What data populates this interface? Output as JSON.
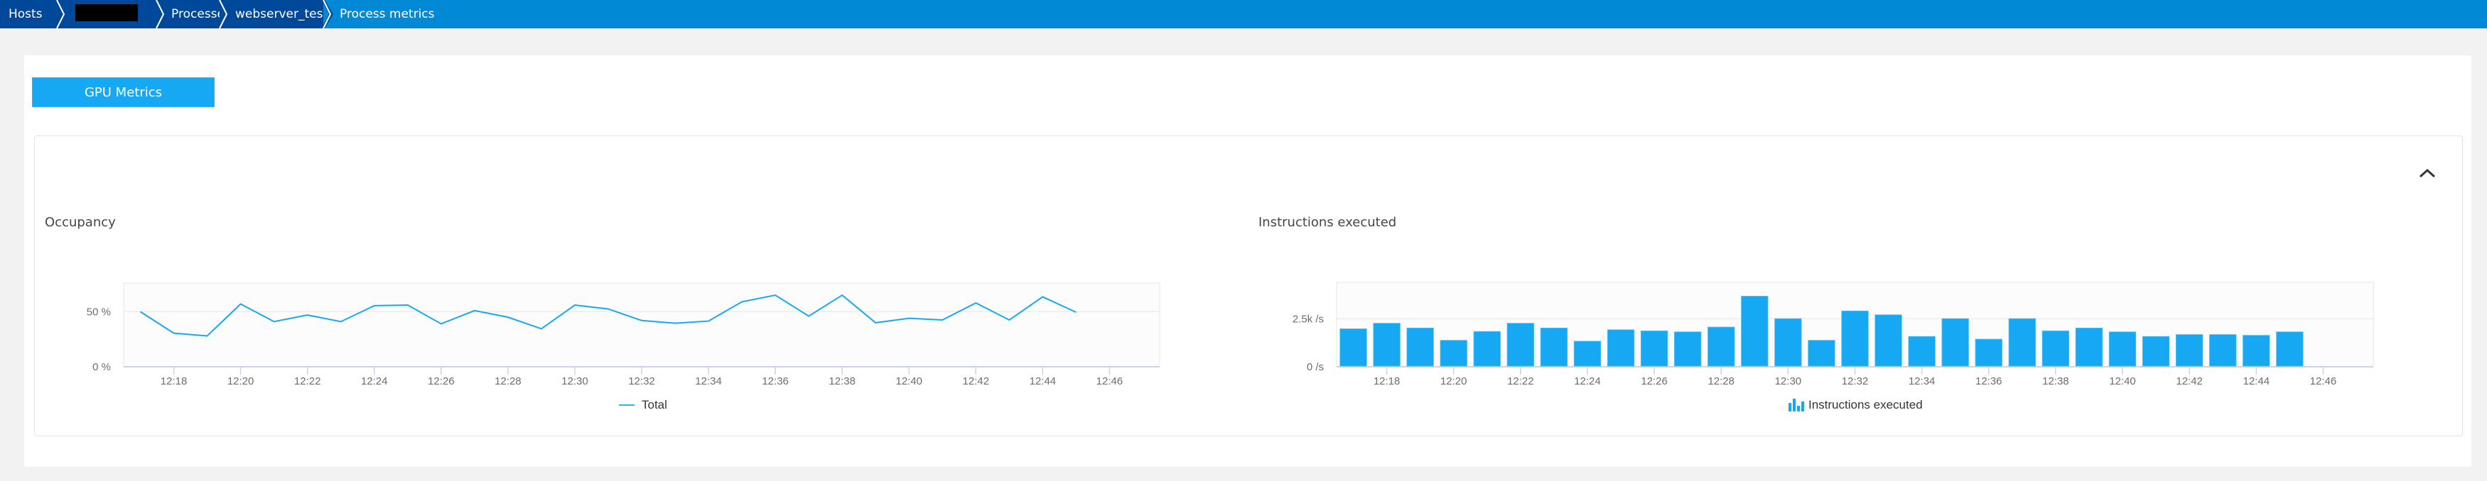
{
  "breadcrumb": {
    "items": [
      {
        "label": "Hosts"
      },
      {
        "label": "",
        "redacted": true
      },
      {
        "label": "Processes"
      },
      {
        "label": "webserver_test_app"
      },
      {
        "label": "Process metrics",
        "current": true
      }
    ]
  },
  "section": {
    "tab_label": "GPU Metrics",
    "collapse_icon": "chevron-up-icon"
  },
  "colors": {
    "breadcrumb_dark": "#00489a",
    "breadcrumb_current": "#0189d6",
    "accent": "#16a8f3",
    "series": "#16a8f3"
  },
  "chart_data": [
    {
      "type": "line",
      "title": "Occupancy",
      "xlabel": "",
      "ylabel": "",
      "x": [
        "12:17",
        "12:18",
        "12:19",
        "12:20",
        "12:21",
        "12:22",
        "12:23",
        "12:24",
        "12:25",
        "12:26",
        "12:27",
        "12:28",
        "12:29",
        "12:30",
        "12:31",
        "12:32",
        "12:33",
        "12:34",
        "12:35",
        "12:36",
        "12:37",
        "12:38",
        "12:39",
        "12:40",
        "12:41",
        "12:42",
        "12:43",
        "12:44",
        "12:45"
      ],
      "series": [
        {
          "name": "Total",
          "values": [
            50,
            30.5,
            28,
            57,
            41,
            47,
            41,
            55.5,
            56,
            39,
            51,
            45,
            34.5,
            56,
            52.5,
            42,
            39.5,
            41.5,
            59,
            65,
            46,
            65,
            40,
            44,
            42.5,
            58,
            42.5,
            63.5,
            49.5
          ]
        }
      ],
      "x_ticks": [
        "12:18",
        "12:20",
        "12:22",
        "12:24",
        "12:26",
        "12:28",
        "12:30",
        "12:32",
        "12:34",
        "12:36",
        "12:38",
        "12:40",
        "12:42",
        "12:44",
        "12:46"
      ],
      "y_ticks": [
        {
          "value": 0,
          "label": "0 %"
        },
        {
          "value": 50,
          "label": "50 %"
        }
      ],
      "ylim": [
        0,
        76
      ],
      "xlim": [
        "12:16.5",
        "12:47.5"
      ],
      "grid": true,
      "legend": {
        "position": "bottom-center",
        "entries": [
          "Total"
        ]
      }
    },
    {
      "type": "bar",
      "title": "Instructions executed",
      "xlabel": "",
      "ylabel": "",
      "x": [
        "12:17",
        "12:18",
        "12:19",
        "12:20",
        "12:21",
        "12:22",
        "12:23",
        "12:24",
        "12:25",
        "12:26",
        "12:27",
        "12:28",
        "12:29",
        "12:30",
        "12:31",
        "12:32",
        "12:33",
        "12:34",
        "12:35",
        "12:36",
        "12:37",
        "12:38",
        "12:39",
        "12:40",
        "12:41",
        "12:42",
        "12:43",
        "12:44",
        "12:45"
      ],
      "series": [
        {
          "name": "Instructions executed",
          "unit": "/s",
          "values": [
            1980,
            2270,
            2020,
            1380,
            1840,
            2270,
            2020,
            1335,
            1930,
            1870,
            1820,
            2070,
            3680,
            2510,
            1380,
            2910,
            2710,
            1580,
            2510,
            1440,
            2510,
            1870,
            2020,
            1820,
            1580,
            1680,
            1680,
            1640,
            1820
          ]
        }
      ],
      "x_ticks": [
        "12:18",
        "12:20",
        "12:22",
        "12:24",
        "12:26",
        "12:28",
        "12:30",
        "12:32",
        "12:34",
        "12:36",
        "12:38",
        "12:40",
        "12:42",
        "12:44",
        "12:46"
      ],
      "y_ticks": [
        {
          "value": 0,
          "label": "0 /s"
        },
        {
          "value": 2500,
          "label": "2.5k /s"
        }
      ],
      "ylim": [
        0,
        4400
      ],
      "xlim": [
        "12:16.5",
        "12:47.5"
      ],
      "grid": true,
      "legend": {
        "position": "bottom-center",
        "entries": [
          "Instructions executed"
        ]
      }
    }
  ]
}
